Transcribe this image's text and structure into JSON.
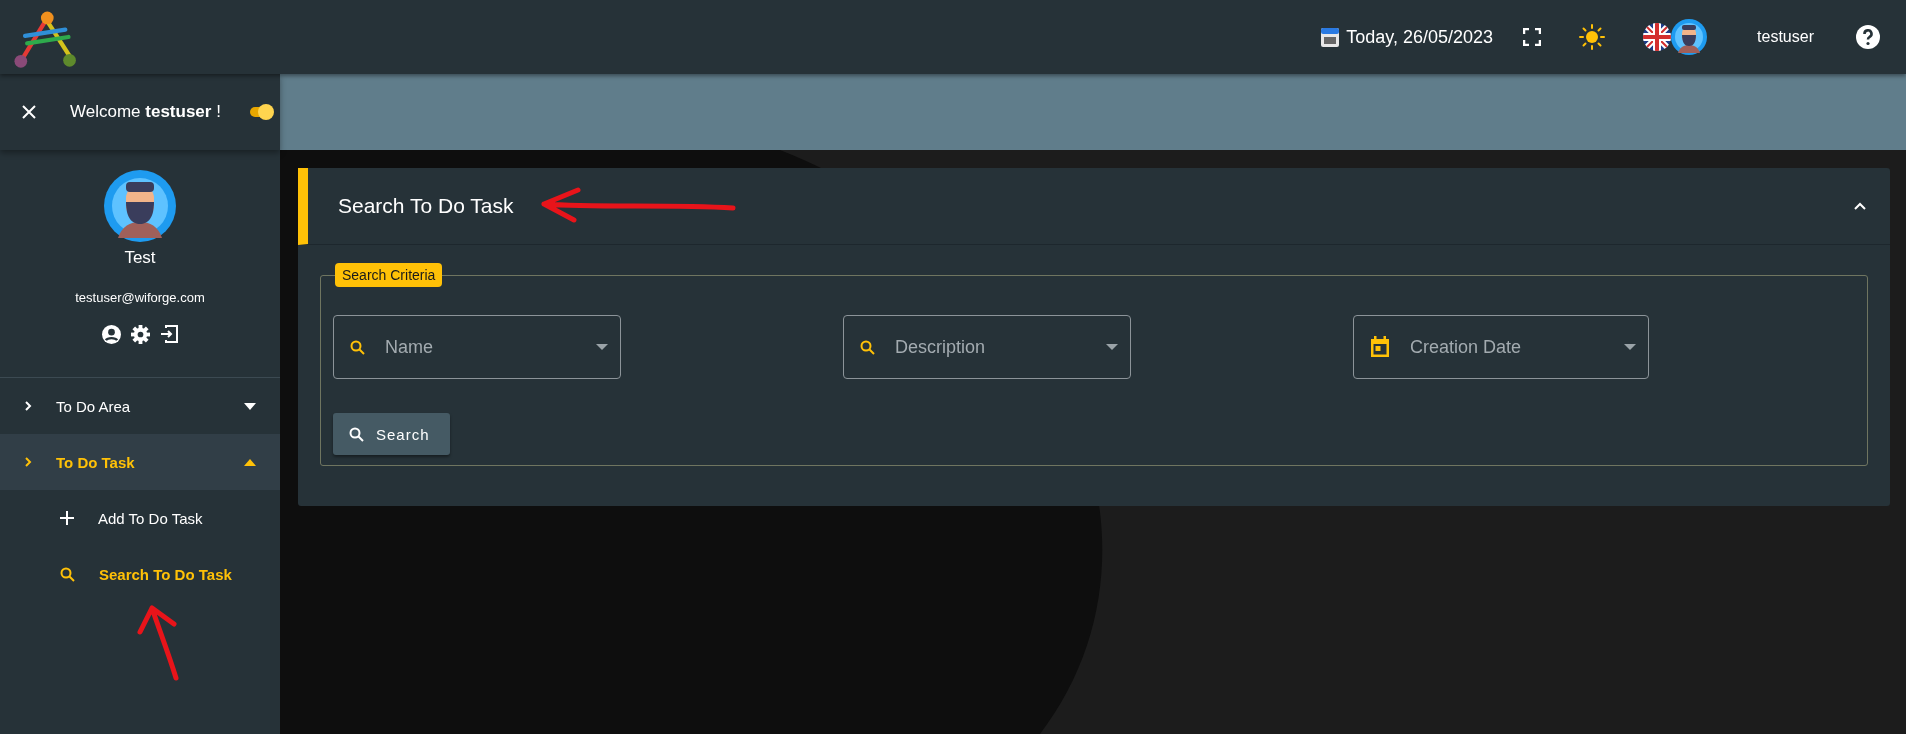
{
  "header": {
    "date": "Today, 26/05/2023",
    "user": "testuser"
  },
  "sidebar": {
    "welcome": "Welcome **testuser** !",
    "toggle": {
      "on": true
    },
    "profile": {
      "name": "Test",
      "email": "testuser@wiforge.com"
    },
    "menu": [
      {
        "label": "To Do Area",
        "expanded": false,
        "selected": false
      },
      {
        "label": "To Do Task",
        "expanded": true,
        "selected": true,
        "children": [
          {
            "label": "Add To Do Task",
            "kind": "add",
            "selected": false
          },
          {
            "label": "Search To Do Task",
            "kind": "search",
            "selected": true
          }
        ]
      }
    ]
  },
  "panel": {
    "title": "Search To Do Task",
    "expanded": true,
    "legend": "Search Criteria",
    "fields": [
      {
        "placeholder": "Name",
        "kind": "search"
      },
      {
        "placeholder": "Description",
        "kind": "search"
      },
      {
        "placeholder": "Creation Date",
        "kind": "date"
      }
    ],
    "button": "Search"
  }
}
